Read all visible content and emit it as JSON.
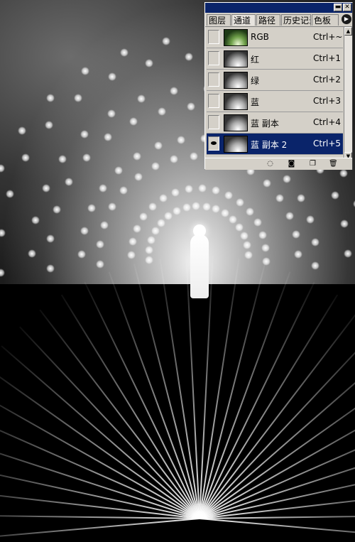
{
  "panel": {
    "tabs": [
      {
        "label": "图层",
        "active": false
      },
      {
        "label": "通道",
        "active": true
      },
      {
        "label": "路径",
        "active": false
      },
      {
        "label": "历史记录",
        "active": false
      },
      {
        "label": "色板",
        "active": false
      }
    ],
    "menu_icon": "triangle-right-icon",
    "window_buttons": {
      "minimize": "▬",
      "close": "✕"
    },
    "channels": [
      {
        "name": "RGB",
        "shortcut": "Ctrl+~",
        "visible": false,
        "selected": false
      },
      {
        "name": "红",
        "shortcut": "Ctrl+1",
        "visible": false,
        "selected": false
      },
      {
        "name": "绿",
        "shortcut": "Ctrl+2",
        "visible": false,
        "selected": false
      },
      {
        "name": "蓝",
        "shortcut": "Ctrl+3",
        "visible": false,
        "selected": false
      },
      {
        "name": "蓝 副本",
        "shortcut": "Ctrl+4",
        "visible": false,
        "selected": false
      },
      {
        "name": "蓝 副本 2",
        "shortcut": "Ctrl+5",
        "visible": true,
        "selected": true
      }
    ],
    "bottom_icons": [
      "load-selection-icon",
      "save-selection-icon",
      "new-channel-icon",
      "delete-channel-icon"
    ]
  },
  "colors": {
    "panel_bg": "#d4d0c8",
    "selection": "#0a246a",
    "titlebar": "#0a246a"
  }
}
